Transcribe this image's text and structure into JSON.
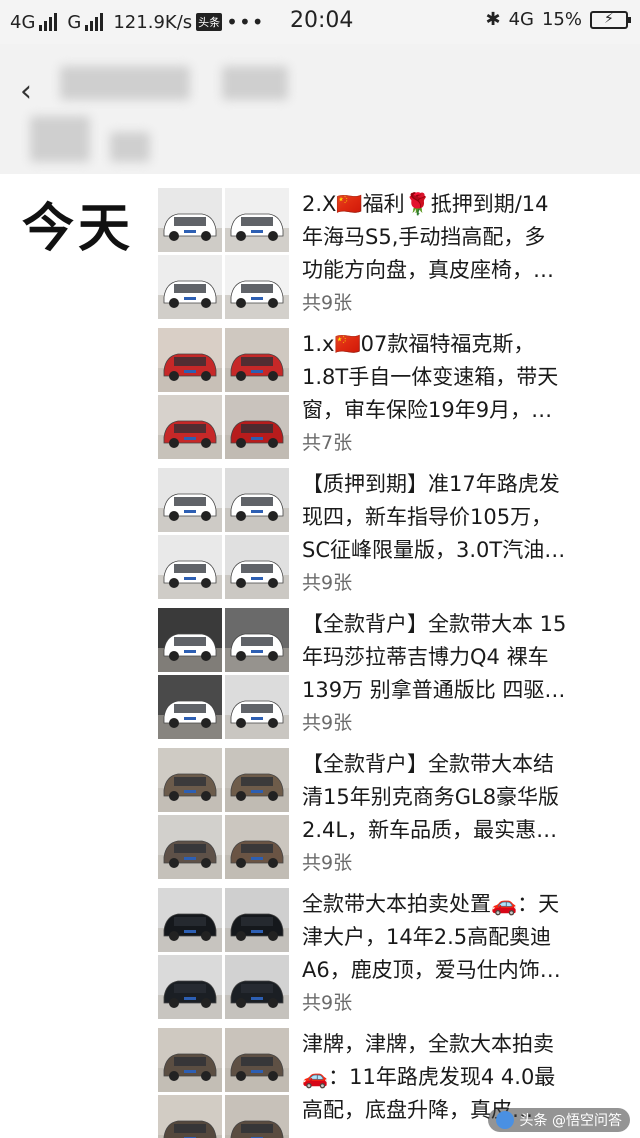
{
  "status_bar": {
    "net1": "4G",
    "net2": "G",
    "speed": "121.9K/s",
    "toutiao": "头条",
    "dots": "•••",
    "time": "20:04",
    "bluetooth": "✱",
    "net3": "4G",
    "battery": "15%"
  },
  "header": {
    "back": "‹"
  },
  "feed": {
    "date_label": "今天",
    "posts": [
      {
        "lines": [
          "2.X🇨🇳福利🌹抵押到期/14",
          "年海马S5,手动挡高配，多",
          "功能方向盘，真皮座椅，…"
        ],
        "count": "共9张",
        "colors": [
          "#e8e8e8",
          "#f0f0f0",
          "#ededed",
          "#f2f2f2"
        ],
        "car": [
          "#ffffff",
          "#ffffff",
          "#ffffff",
          "#ffffff"
        ]
      },
      {
        "lines": [
          "1.x🇨🇳07款福特福克斯，",
          "1.8T手自一体变速箱，带天",
          "窗，审车保险19年9月，…"
        ],
        "count": "共7张",
        "colors": [
          "#d9cfc6",
          "#cfc8c0",
          "#d7d2cc",
          "#c9c3bd"
        ],
        "car": [
          "#c62828",
          "#c62828",
          "#c62828",
          "#b71c1c"
        ]
      },
      {
        "lines": [
          "【质押到期】准17年路虎发",
          "现四，新车指导价105万，",
          "SC征峰限量版，3.0T汽油…"
        ],
        "count": "共9张",
        "colors": [
          "#e6e6e6",
          "#dcdcdc",
          "#e9e9e9",
          "#e0e0e0"
        ],
        "car": [
          "#ffffff",
          "#ffffff",
          "#ffffff",
          "#ffffff"
        ]
      },
      {
        "lines": [
          "【全款背户】全款带大本 15",
          "年玛莎拉蒂吉博力Q4 裸车",
          "139万 别拿普通版比 四驱…"
        ],
        "count": "共9张",
        "colors": [
          "#3a3a3a",
          "#6a6a6a",
          "#4a4a4a",
          "#dcdcdc"
        ],
        "car": [
          "#ffffff",
          "#ffffff",
          "#ffffff",
          "#ffffff"
        ]
      },
      {
        "lines": [
          "【全款背户】全款带大本结",
          "清15年别克商务GL8豪华版",
          "2.4L，新车品质，最实惠…"
        ],
        "count": "共9张",
        "colors": [
          "#cfcbc4",
          "#c8c4bd",
          "#d2d0cc",
          "#cbc6bf"
        ],
        "car": [
          "#6b5b4b",
          "#6e5c4a",
          "#5e5148",
          "#6a5444"
        ]
      },
      {
        "lines": [
          "全款带大本拍卖处置🚗：天",
          "津大户，14年2.5高配奥迪",
          "A6，鹿皮顶，爱马仕内饰…"
        ],
        "count": "共9张",
        "colors": [
          "#d8d8d8",
          "#cfcfcf",
          "#dadada",
          "#d2d2d2"
        ],
        "car": [
          "#15181c",
          "#15181c",
          "#1b1f24",
          "#1b1f24"
        ]
      },
      {
        "lines": [
          "津牌，津牌，全款大本拍卖",
          "🚗：11年路虎发现4  4.0最",
          "高配，底盘升降，真皮…"
        ],
        "count": "",
        "colors": [
          "#cfc9c1",
          "#c9c3bb",
          "#d2ccc4",
          "#c7c1b9"
        ],
        "car": [
          "#5b4e42",
          "#5e5044",
          "#54483d",
          "#5a4c40"
        ]
      }
    ]
  },
  "watermark": "头条 @悟空问答"
}
